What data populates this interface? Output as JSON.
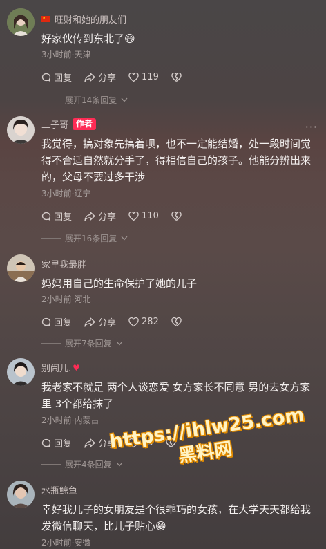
{
  "comments": [
    {
      "username": "旺财和她的朋友们",
      "username_flag": "🇨🇳",
      "text": "好家伙传到东北了😅",
      "meta": "3小时前·天津",
      "reply": "回复",
      "share": "分享",
      "likes": "119",
      "expand": "展开14条回复"
    },
    {
      "username": "二子哥",
      "author_tag": "作者",
      "more": "···",
      "text": "我觉得，搞对象先搞着呗，也不一定能结婚，处一段时间觉得不合适自然就分手了，得相信自己的孩子。他能分辨出来的，父母不要过多干涉",
      "meta": "3小时前·辽宁",
      "reply": "回复",
      "share": "分享",
      "likes": "110",
      "expand": "展开16条回复"
    },
    {
      "username": "家里我最胖",
      "text": "妈妈用自己的生命保护了她的儿子",
      "meta": "2小时前·河北",
      "reply": "回复",
      "share": "分享",
      "likes": "282",
      "expand": "展开7条回复"
    },
    {
      "username": "别闹儿.",
      "username_heart": "♥",
      "text": "我老家不就是  两个人谈恋爱  女方家长不同意  男的去女方家里  3个都给抹了",
      "meta": "2小时前·内蒙古",
      "reply": "回复",
      "share": "分享",
      "likes": "13",
      "expand": "展开4条回复"
    },
    {
      "username": "水瓶鲸鱼",
      "text": "幸好我儿子的女朋友是个很乖巧的女孩，在大学天天都给我发微信聊天，比儿子贴心😁",
      "meta": "2小时前·安徽"
    }
  ],
  "watermark": {
    "url": "https://ihlw25.com",
    "name": "黑料网"
  }
}
